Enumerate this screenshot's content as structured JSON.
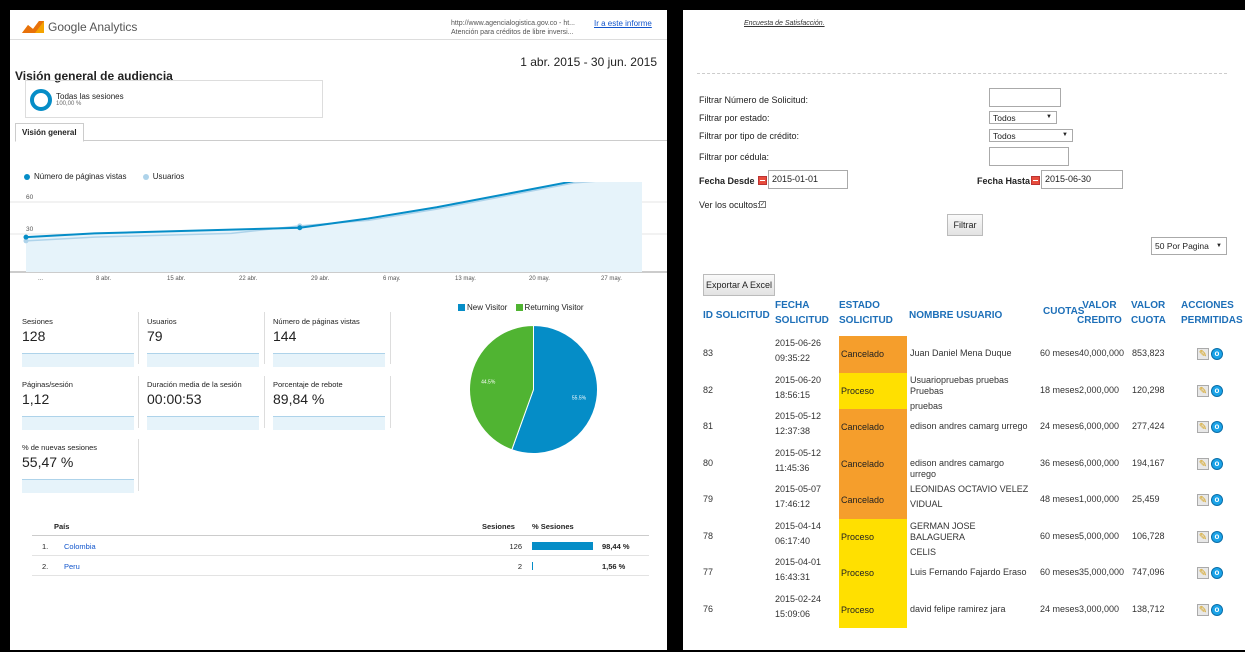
{
  "ga": {
    "brand": "Google Analytics",
    "url_line1": "http://www.agencialogistica.gov.co - ht...",
    "url_line2": "Atención para créditos de libre inversi...",
    "report_link": "Ir a este informe",
    "title": "Visión general de audiencia",
    "date_range": "1 abr. 2015 - 30 jun. 2015",
    "segment_name": "Todas las sesiones",
    "segment_pct": "100,00 %",
    "tab": "Visión general",
    "legend": [
      {
        "label": "Número de páginas vistas",
        "color": "#058dc7"
      },
      {
        "label": "Usuarios",
        "color": "#aed3ea"
      }
    ],
    "metrics": [
      {
        "label": "Sesiones",
        "value": "128"
      },
      {
        "label": "Usuarios",
        "value": "79"
      },
      {
        "label": "Número de páginas vistas",
        "value": "144"
      },
      {
        "label": "Páginas/sesión",
        "value": "1,12"
      },
      {
        "label": "Duración media de la sesión",
        "value": "00:00:53"
      },
      {
        "label": "Porcentaje de rebote",
        "value": "89,84 %"
      },
      {
        "label": "% de nuevas sesiones",
        "value": "55,47 %"
      }
    ],
    "countries": {
      "headers": {
        "country": "País",
        "sessions": "Sesiones",
        "pct": "% Sesiones"
      },
      "rows": [
        {
          "num": "1.",
          "name": "Colombia",
          "sessions": "126",
          "pct": "98,44 %",
          "share": 0.9844
        },
        {
          "num": "2.",
          "name": "Peru",
          "sessions": "2",
          "pct": "1,56 %",
          "share": 0.0156
        }
      ]
    }
  },
  "chart_data": [
    {
      "type": "line",
      "x": [
        "...",
        "8 abr.",
        "15 abr.",
        "22 abr.",
        "29 abr.",
        "6 may.",
        "13 may.",
        "20 may.",
        "27 may."
      ],
      "y_left_ticks": [
        "60",
        "30"
      ],
      "y_right_ticks": [
        "40",
        "20"
      ],
      "series": [
        {
          "name": "Número de páginas vistas",
          "color": "#058dc7",
          "values": [
            8,
            10,
            11,
            12,
            13,
            18,
            24,
            31,
            38,
            41
          ]
        },
        {
          "name": "Usuarios",
          "color": "#aed3ea",
          "values": [
            6,
            8,
            9,
            10,
            14,
            17,
            23,
            30,
            37,
            40
          ]
        }
      ]
    },
    {
      "type": "pie",
      "series": [
        {
          "name": "New Visitor",
          "color": "#058dc7",
          "value": 55.5,
          "label": "55.5%"
        },
        {
          "name": "Returning Visitor",
          "color": "#50b432",
          "value": 44.5,
          "label": "44.5%"
        }
      ]
    }
  ],
  "solicitudes": {
    "survey_link": "Encuesta de Satisfacción.",
    "filters": {
      "numero_label": "Filtrar Número de Solicitud:",
      "numero_value": "",
      "estado_label": "Filtrar por estado:",
      "estado_value": "Todos",
      "tipo_label": "Filtrar por tipo de crédito:",
      "tipo_value": "Todos",
      "cedula_label": "Filtrar por cédula:",
      "cedula_value": "",
      "desde_label": "Fecha Desde",
      "desde_value": "2015-01-01",
      "hasta_label": "Fecha Hasta",
      "hasta_value": "2015-06-30",
      "ocultos_label": "Ver los ocultos:",
      "ocultos_checked": "✓"
    },
    "filter_button": "Filtrar",
    "per_page": "50 Por Pagina",
    "export_button": "Exportar A Excel",
    "headers": {
      "id": "ID SOLICITUD",
      "fecha1": "FECHA",
      "fecha2": "SOLICITUD",
      "estado1": "ESTADO",
      "estado2": "SOLICITUD",
      "usuario": "NOMBRE USUARIO",
      "cuotas": "CUOTAS",
      "valor_credito1": "VALOR",
      "valor_credito2": "CREDITO",
      "valor_cuota1": "VALOR",
      "valor_cuota2": "CUOTA",
      "acciones1": "ACCIONES",
      "acciones2": "PERMITIDAS"
    },
    "rows": [
      {
        "id": "83",
        "date": "2015-06-26",
        "time": "09:35:22",
        "status": "Cancelado",
        "kind": "cancel",
        "user1": "Juan Daniel Mena Duque",
        "user2": "",
        "cuotas": "60 meses",
        "credito": "40,000,000",
        "cuota": "853,823"
      },
      {
        "id": "82",
        "date": "2015-06-20",
        "time": "18:56:15",
        "status": "Proceso",
        "kind": "proc",
        "user1": "Usuariopruebas pruebas Pruebas",
        "user2": "pruebas",
        "cuotas": "18 meses",
        "credito": "2,000,000",
        "cuota": "120,298"
      },
      {
        "id": "81",
        "date": "2015-05-12",
        "time": "12:37:38",
        "status": "Cancelado",
        "kind": "cancel",
        "user1": "edison andres camarg urrego",
        "user2": "",
        "cuotas": "24 meses",
        "credito": "6,000,000",
        "cuota": "277,424"
      },
      {
        "id": "80",
        "date": "2015-05-12",
        "time": "11:45:36",
        "status": "Cancelado",
        "kind": "cancel",
        "user1": "edison andres camargo urrego",
        "user2": "",
        "cuotas": "36 meses",
        "credito": "6,000,000",
        "cuota": "194,167"
      },
      {
        "id": "79",
        "date": "2015-05-07",
        "time": "17:46:12",
        "status": "Cancelado",
        "kind": "cancel",
        "user1": "LEONIDAS OCTAVIO VELEZ",
        "user2": "VIDUAL",
        "cuotas": "48 meses",
        "credito": "1,000,000",
        "cuota": "25,459"
      },
      {
        "id": "78",
        "date": "2015-04-14",
        "time": "06:17:40",
        "status": "Proceso",
        "kind": "proc",
        "user1": "GERMAN JOSE BALAGUERA",
        "user2": "CELIS",
        "cuotas": "60 meses",
        "credito": "5,000,000",
        "cuota": "106,728"
      },
      {
        "id": "77",
        "date": "2015-04-01",
        "time": "16:43:31",
        "status": "Proceso",
        "kind": "proc",
        "user1": "Luis Fernando Fajardo Eraso",
        "user2": "",
        "cuotas": "60 meses",
        "credito": "35,000,000",
        "cuota": "747,096"
      },
      {
        "id": "76",
        "date": "2015-02-24",
        "time": "15:09:06",
        "status": "Proceso",
        "kind": "proc",
        "user1": "david felipe ramirez jara",
        "user2": "",
        "cuotas": "24 meses",
        "credito": "3,000,000",
        "cuota": "138,712"
      }
    ]
  }
}
